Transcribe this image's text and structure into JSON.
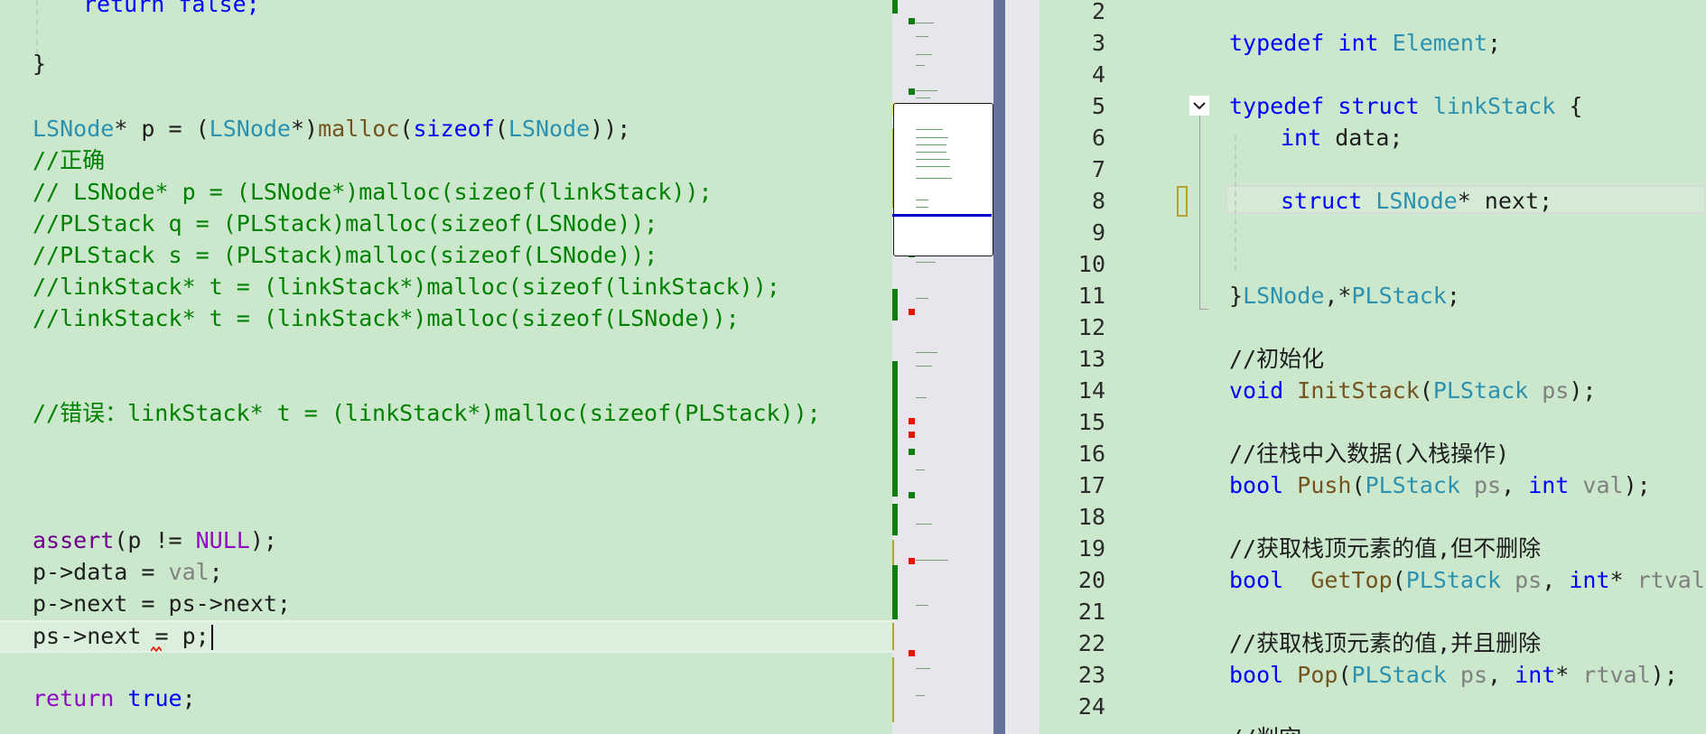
{
  "left_editor": {
    "lines": {
      "l0": "return false;",
      "l1": "}",
      "l2_type": "LSNode",
      "l2_rest1": "* p = (",
      "l2_type2": "LSNode",
      "l2_rest2": "*)",
      "l2_fn": "malloc",
      "l2_p1": "(",
      "l2_kw": "sizeof",
      "l2_p2": "(",
      "l2_type3": "LSNode",
      "l2_end": "));",
      "l3": "//正确",
      "l4": "// LSNode* p = (LSNode*)malloc(sizeof(linkStack));",
      "l5": "//PLStack q = (PLStack)malloc(sizeof(LSNode));",
      "l6": "//PLStack s = (PLStack)malloc(sizeof(LSNode));",
      "l7": "//linkStack* t = (linkStack*)malloc(sizeof(linkStack));",
      "l8": "//linkStack* t = (linkStack*)malloc(sizeof(LSNode));",
      "l9": "//错误：linkStack* t = (linkStack*)malloc(sizeof(PLStack));",
      "l10_fn": "assert",
      "l10_a": "(p != ",
      "l10_mac": "NULL",
      "l10_b": ");",
      "l11_a": "p->data = ",
      "l11_par": "val",
      "l11_b": ";",
      "l12": "p->next = ps->next;",
      "l13_a": "ps->next = p;",
      "l14_kw": "return",
      "l14_val": "true",
      "l14_end": ";"
    }
  },
  "right_editor": {
    "line_numbers": [
      "2",
      "3",
      "4",
      "5",
      "6",
      "7",
      "8",
      "9",
      "10",
      "11",
      "12",
      "13",
      "14",
      "15",
      "16",
      "17",
      "18",
      "19",
      "20",
      "21",
      "22",
      "23",
      "24"
    ],
    "code": {
      "r3_kw": "typedef",
      "r3_kw2": "int",
      "r3_ty": "Element",
      "r3_end": ";",
      "r5_kw": "typedef",
      "r5_kw2": "struct",
      "r5_ty": "linkStack",
      "r5_end": " {",
      "r6_kw": "int",
      "r6_rest": " data;",
      "r8_kw": "struct",
      "r8_ty": "LSNode",
      "r8_rest": "* next;",
      "r11_a": "}",
      "r11_ty": "LSNode",
      "r11_b": ",*",
      "r11_ty2": "PLStack",
      "r11_c": ";",
      "r13": "//初始化",
      "r14_kw": "void",
      "r14_fn": "InitStack",
      "r14_p": "(",
      "r14_ty": "PLStack",
      "r14_par": "ps",
      "r14_end": ");",
      "r16": "//往栈中入数据(入栈操作)",
      "r17_kw": "bool",
      "r17_fn": "Push",
      "r17_p": "(",
      "r17_ty": "PLStack",
      "r17_par": "ps",
      "r17_c": ", ",
      "r17_kw2": "int",
      "r17_par2": "val",
      "r17_end": ");",
      "r19": "//获取栈顶元素的值,但不删除",
      "r20_kw": "bool",
      "r20_fn": "GetTop",
      "r20_p": "(",
      "r20_ty": "PLStack",
      "r20_par": "ps",
      "r20_c": ", ",
      "r20_kw2": "int",
      "r20_star": "* ",
      "r20_par2": "rtval",
      "r20_end": ");",
      "r22": "//获取栈顶元素的值,并且删除",
      "r23_kw": "bool",
      "r23_fn": "Pop",
      "r23_p": "(",
      "r23_ty": "PLStack",
      "r23_par": "ps",
      "r23_c": ", ",
      "r23_kw2": "int",
      "r23_star": "* ",
      "r23_par2": "rtval",
      "r23_end": ");",
      "r25": "//判空"
    }
  },
  "colors": {
    "editor_bg": "#cbe8cd",
    "keyword": "#0000ff",
    "type": "#2b91af",
    "function": "#74531f",
    "comment": "#008000",
    "splitter": "#65729d"
  }
}
